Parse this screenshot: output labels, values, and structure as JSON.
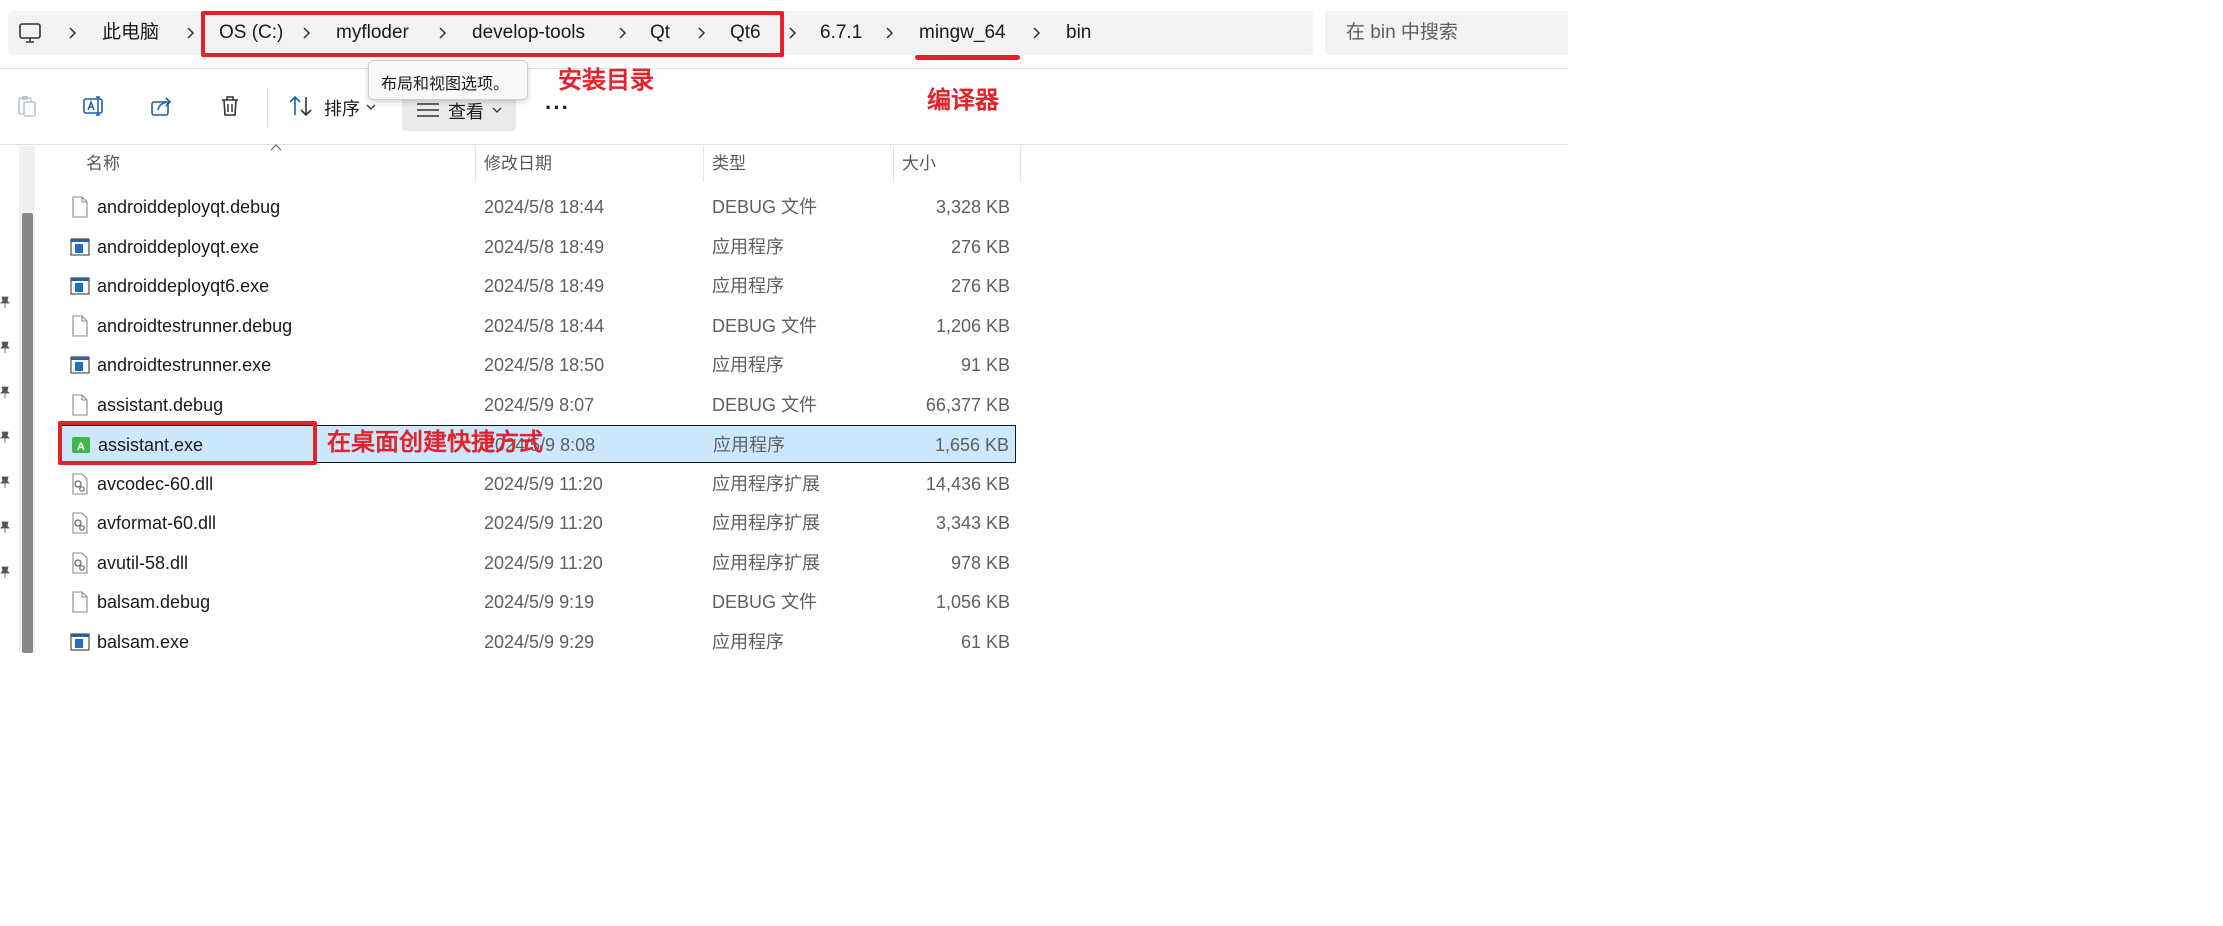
{
  "address": {
    "crumbs": [
      "此电脑",
      "OS (C:)",
      "myfloder",
      "develop-tools",
      "Qt",
      "Qt6",
      "6.7.1",
      "mingw_64",
      "bin"
    ]
  },
  "search": {
    "placeholder": "在 bin 中搜索"
  },
  "toolbar": {
    "sort_label": "排序",
    "view_label": "查看",
    "more_label": "···",
    "tooltip": "布局和视图选项。"
  },
  "columns": {
    "name": "名称",
    "date": "修改日期",
    "type": "类型",
    "size": "大小"
  },
  "files": [
    {
      "name": "androiddeployqt.debug",
      "date": "2024/5/8 18:44",
      "type": "DEBUG 文件",
      "size": "3,328 KB",
      "icon": "file-icon"
    },
    {
      "name": "androiddeployqt.exe",
      "date": "2024/5/8 18:49",
      "type": "应用程序",
      "size": "276 KB",
      "icon": "exe-icon"
    },
    {
      "name": "androiddeployqt6.exe",
      "date": "2024/5/8 18:49",
      "type": "应用程序",
      "size": "276 KB",
      "icon": "exe-icon"
    },
    {
      "name": "androidtestrunner.debug",
      "date": "2024/5/8 18:44",
      "type": "DEBUG 文件",
      "size": "1,206 KB",
      "icon": "file-icon"
    },
    {
      "name": "androidtestrunner.exe",
      "date": "2024/5/8 18:50",
      "type": "应用程序",
      "size": "91 KB",
      "icon": "exe-icon"
    },
    {
      "name": "assistant.debug",
      "date": "2024/5/9 8:07",
      "type": "DEBUG 文件",
      "size": "66,377 KB",
      "icon": "file-icon"
    },
    {
      "name": "assistant.exe",
      "date": "2024/5/9 8:08",
      "type": "应用程序",
      "size": "1,656 KB",
      "icon": "assistant-app-icon",
      "selected": true
    },
    {
      "name": "avcodec-60.dll",
      "date": "2024/5/9 11:20",
      "type": "应用程序扩展",
      "size": "14,436 KB",
      "icon": "dll-icon"
    },
    {
      "name": "avformat-60.dll",
      "date": "2024/5/9 11:20",
      "type": "应用程序扩展",
      "size": "3,343 KB",
      "icon": "dll-icon"
    },
    {
      "name": "avutil-58.dll",
      "date": "2024/5/9 11:20",
      "type": "应用程序扩展",
      "size": "978 KB",
      "icon": "dll-icon"
    },
    {
      "name": "balsam.debug",
      "date": "2024/5/9 9:19",
      "type": "DEBUG 文件",
      "size": "1,056 KB",
      "icon": "file-icon"
    },
    {
      "name": "balsam.exe",
      "date": "2024/5/9 9:29",
      "type": "应用程序",
      "size": "61 KB",
      "icon": "exe-icon"
    }
  ],
  "annotations": {
    "install_dir": "安装目录",
    "compiler": "编译器",
    "shortcut": "在桌面创建快捷方式"
  },
  "colors": {
    "annotation_red": "#e3222a",
    "selection_blue": "#cce8ff",
    "exe_blue": "#1f6fc0",
    "assistant_green": "#41b649"
  }
}
